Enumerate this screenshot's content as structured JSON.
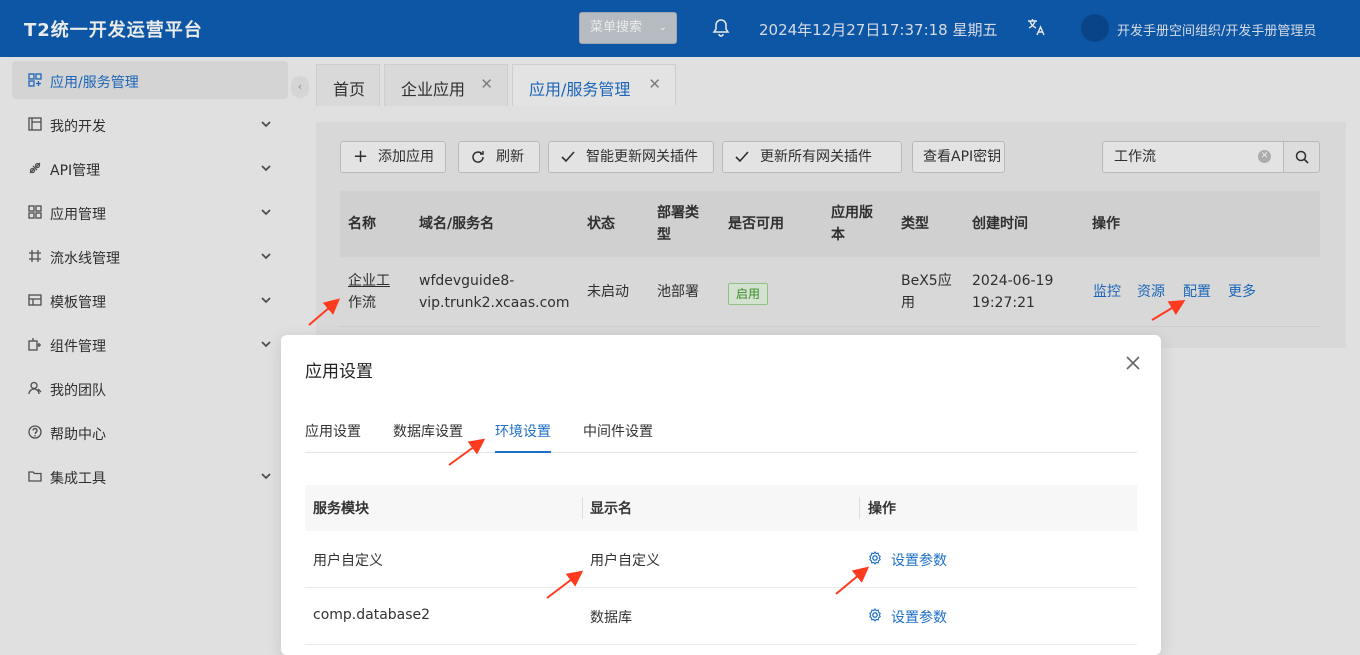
{
  "header": {
    "title": "T2统一开发运营平台",
    "menu_search": "菜单搜索",
    "datetime": "2024年12月27日17:37:18 星期五",
    "user": "开发手册空间组织/开发手册管理员"
  },
  "sidebar": {
    "items": [
      {
        "label": "应用/服务管理",
        "icon": "app-service-icon"
      },
      {
        "label": "我的开发",
        "icon": "dev-icon"
      },
      {
        "label": "API管理",
        "icon": "api-icon"
      },
      {
        "label": "应用管理",
        "icon": "grid-icon"
      },
      {
        "label": "流水线管理",
        "icon": "pipeline-icon"
      },
      {
        "label": "模板管理",
        "icon": "template-icon"
      },
      {
        "label": "组件管理",
        "icon": "component-icon"
      },
      {
        "label": "我的团队",
        "icon": "team-icon"
      },
      {
        "label": "帮助中心",
        "icon": "help-icon"
      },
      {
        "label": "集成工具",
        "icon": "folder-icon"
      }
    ]
  },
  "tabs": [
    {
      "label": "首页"
    },
    {
      "label": "企业应用"
    },
    {
      "label": "应用/服务管理"
    }
  ],
  "toolbar": {
    "add": "添加应用",
    "refresh": "刷新",
    "smart_update": "智能更新网关插件",
    "update_all": "更新所有网关插件",
    "view_key": "查看API密钥",
    "search_value": "工作流"
  },
  "table": {
    "columns": {
      "name": "名称",
      "domain": "域名/服务名",
      "status": "状态",
      "deploy_a": "部署类",
      "deploy_b": "型",
      "available": "是否可用",
      "version_a": "应用版",
      "version_b": "本",
      "type": "类型",
      "created": "创建时间",
      "ops": "操作"
    },
    "row": {
      "name_a": "企业工",
      "name_b": "作流",
      "domain_a": "wfdevguide8-",
      "domain_b": "vip.trunk2.xcaas.com",
      "status": "未启动",
      "deploy": "池部署",
      "available": "启用",
      "type_a": "BeX5应",
      "type_b": "用",
      "created_a": "2024-06-19",
      "created_b": "19:27:21",
      "op_monitor": "监控",
      "op_resource": "资源",
      "op_config": "配置",
      "op_more": "更多"
    }
  },
  "modal": {
    "title": "应用设置",
    "tabs": [
      "应用设置",
      "数据库设置",
      "环境设置",
      "中间件设置"
    ],
    "columns": {
      "module": "服务模块",
      "display": "显示名",
      "ops": "操作"
    },
    "rows": [
      {
        "module": "用户自定义",
        "display": "用户自定义",
        "action": "设置参数"
      },
      {
        "module": "comp.database2",
        "display": "数据库",
        "action": "设置参数"
      }
    ]
  },
  "colors": {
    "brand": "#0f5db3",
    "link": "#1e6fc8",
    "annotation": "#ff3b1f",
    "success": "#3c9a2a"
  }
}
